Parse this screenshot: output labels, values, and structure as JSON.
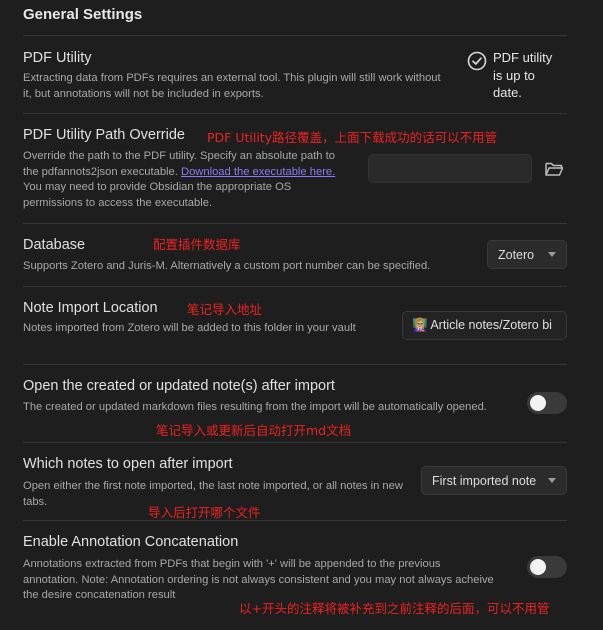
{
  "heading": "General Settings",
  "pdf_utility": {
    "name": "PDF Utility",
    "description": "Extracting data from PDFs requires an external tool. This plugin will still work without it, but annotations will not be included in exports.",
    "status_lines": [
      "PDF utility",
      "is up to",
      "date."
    ]
  },
  "path_override": {
    "name": "PDF Utility Path Override",
    "note": "PDF Utility路径覆盖，上面下载成功的话可以不用管",
    "desc_before": "Override the path to the PDF utility. Specify an absolute path to the pdfannots2json executable. ",
    "link": "Download the executable here.",
    "desc_after": " You may need to provide Obsidian the appropriate OS permissions to access the executable.",
    "input_value": ""
  },
  "database": {
    "name": "Database",
    "note": "配置插件数据库",
    "description": "Supports Zotero and Juris-M. Alternatively a custom port number can be specified.",
    "selected": "Zotero"
  },
  "note_import": {
    "name": "Note Import Location",
    "note": "笔记导入地址",
    "description": "Notes imported from Zotero will be added to this folder in your vault",
    "value": "👩🏼‍🏫 Article notes/Zotero bi"
  },
  "open_after_import": {
    "name": "Open the created or updated note(s) after import",
    "description": "The created or updated markdown files resulting from the import will be automatically opened.",
    "note": "笔记导入或更新后自动打开md文档",
    "enabled": false
  },
  "which_notes": {
    "name": "Which notes to open after import",
    "description": "Open either the first note imported, the last note imported, or all notes in new tabs.",
    "note": "导入后打开哪个文件",
    "selected": "First imported note"
  },
  "concatenation": {
    "name": "Enable Annotation Concatenation",
    "description": "Annotations extracted from PDFs that begin with '+' will be appended to the previous annotation. Note: Annotation ordering is not always consistent and you may not always acheive the desire concatenation result",
    "note": "以+开头的注释将被补充到之前注释的后面，可以不用管",
    "enabled": false
  }
}
